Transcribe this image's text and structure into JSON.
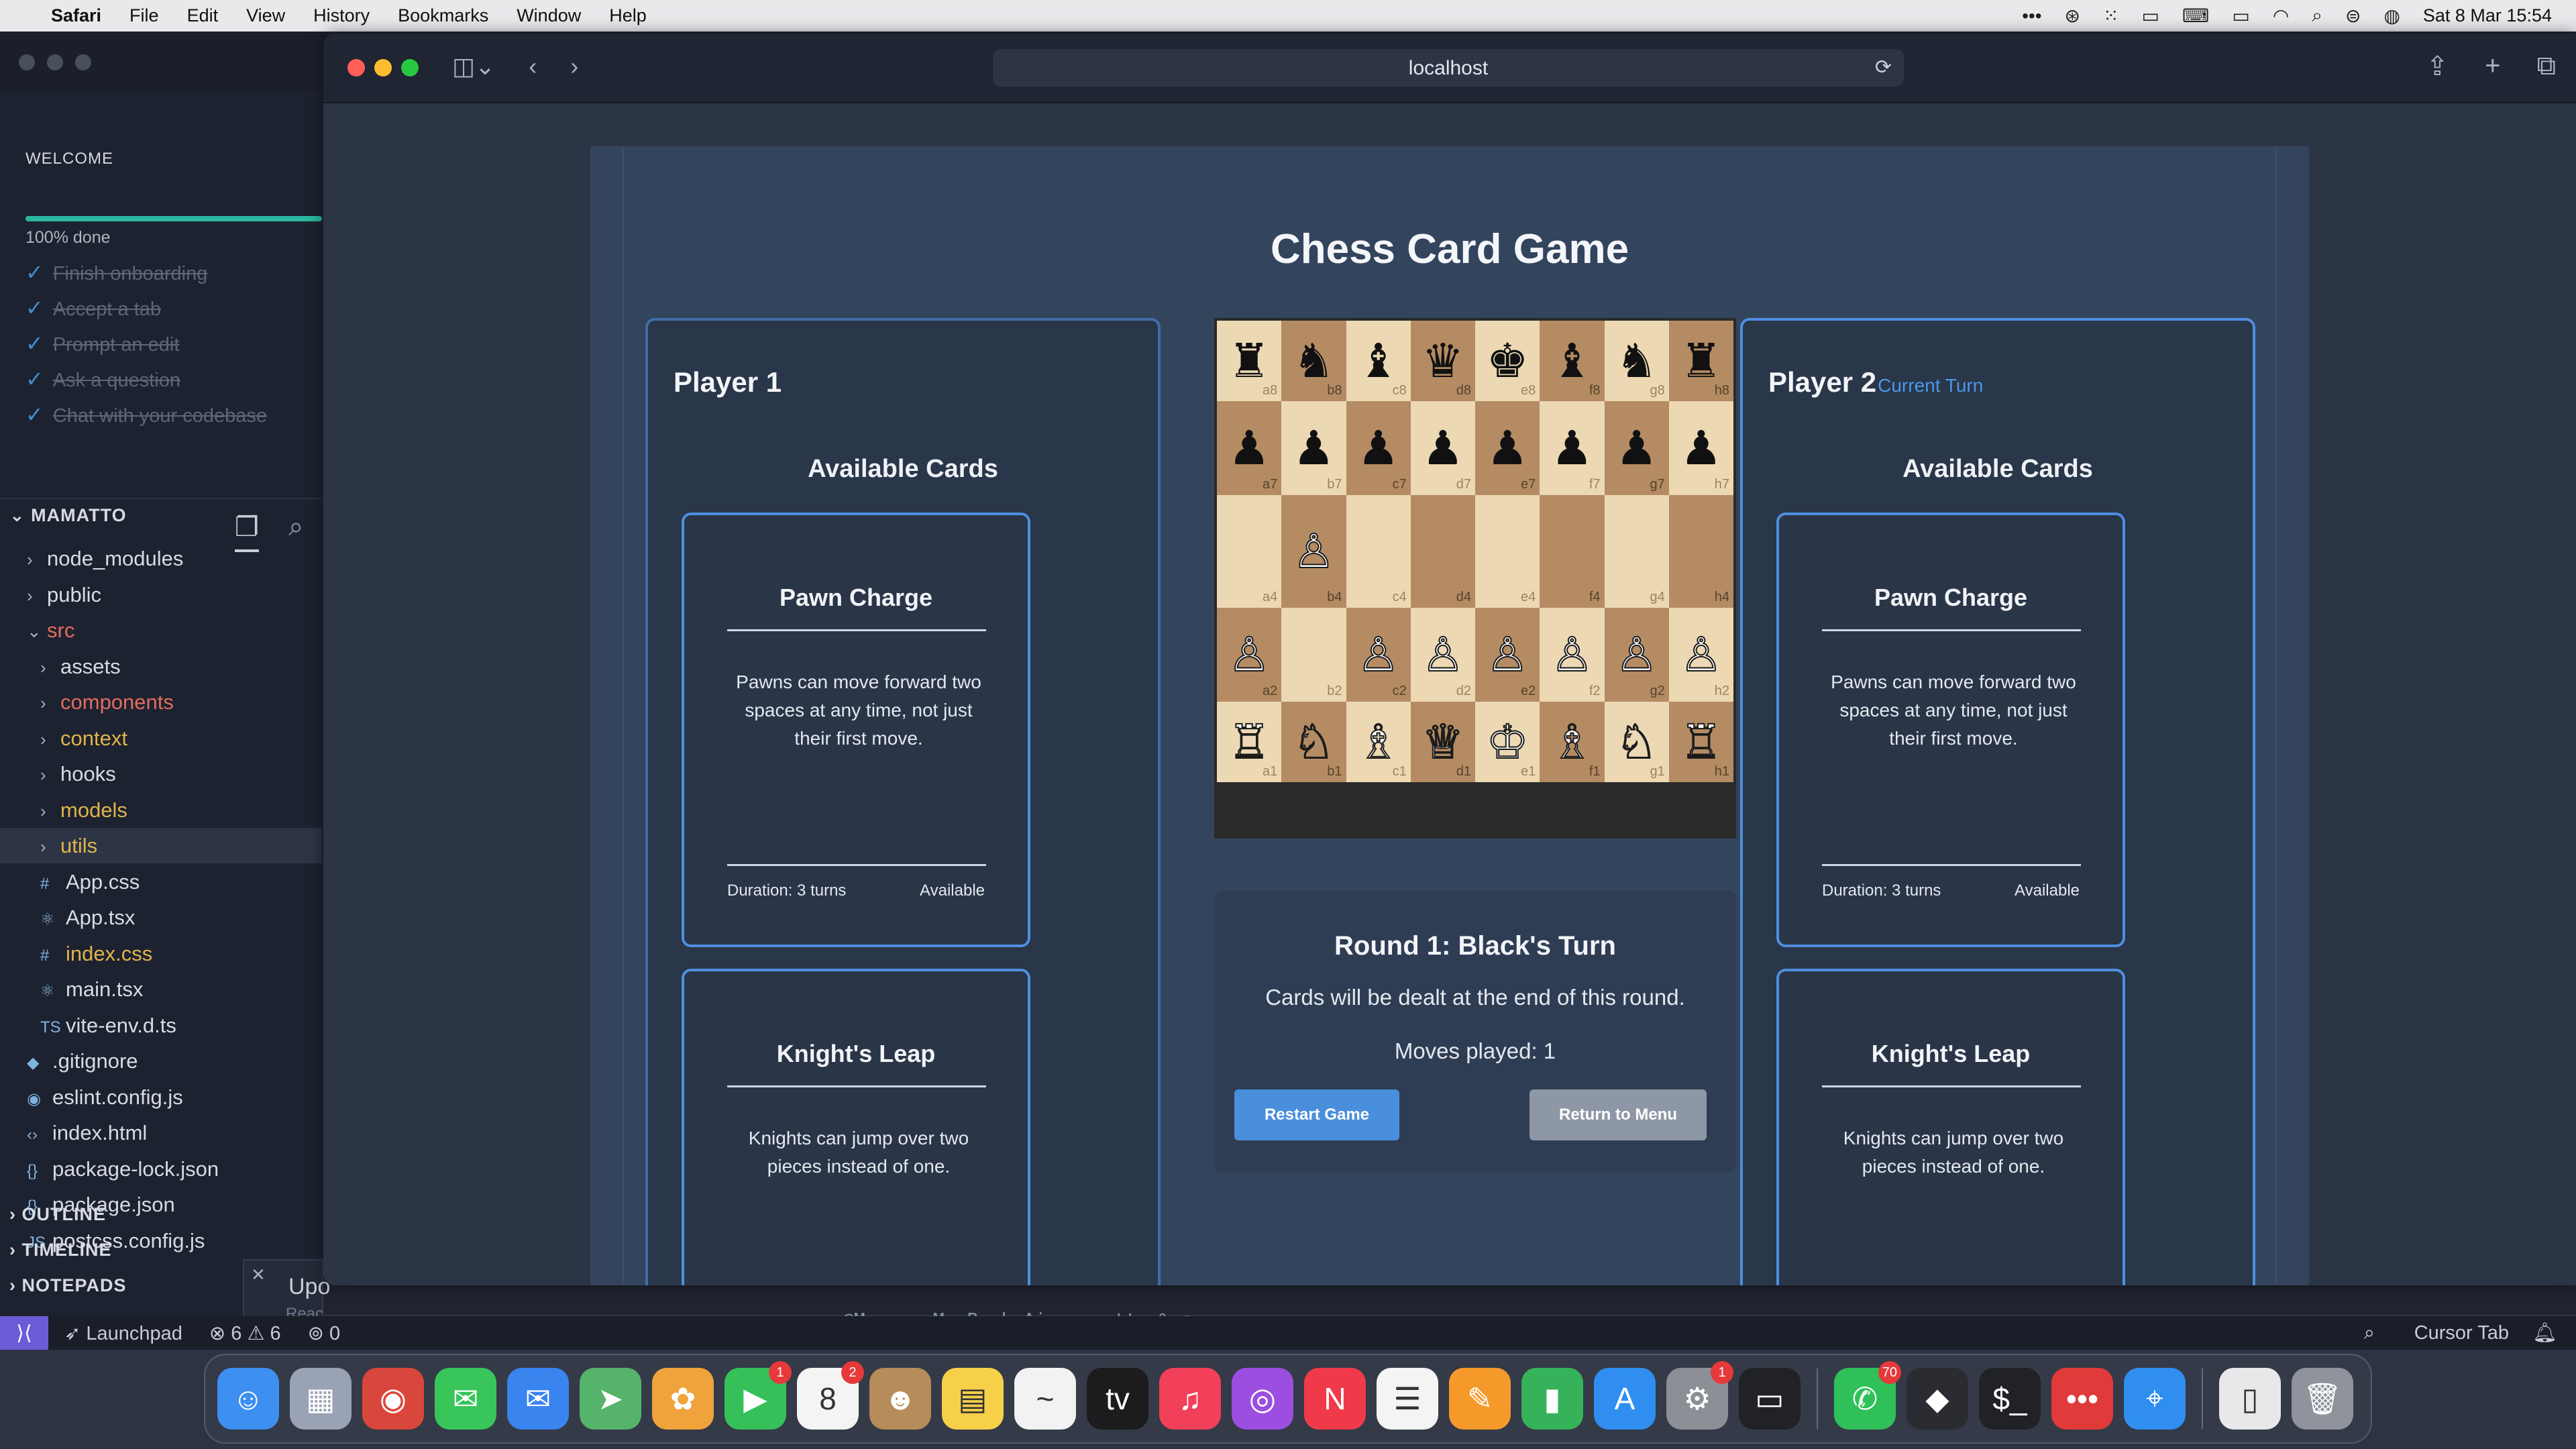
{
  "menubar": {
    "app": "Safari",
    "items": [
      "File",
      "Edit",
      "View",
      "History",
      "Bookmarks",
      "Window",
      "Help"
    ],
    "clock": "Sat 8 Mar  15:54"
  },
  "vscode": {
    "welcome": {
      "title": "WELCOME",
      "progress_pct": 100,
      "progress_label": "100% done",
      "todos": [
        "Finish onboarding",
        "Accept a tab",
        "Prompt an edit",
        "Ask a question",
        "Chat with your codebase"
      ]
    },
    "explorer": {
      "project": "MAMATTO",
      "tree": [
        {
          "label": "node_modules",
          "kind": "folder",
          "depth": 1,
          "color": "normal"
        },
        {
          "label": "public",
          "kind": "folder",
          "depth": 1,
          "color": "normal"
        },
        {
          "label": "src",
          "kind": "folder-open",
          "depth": 1,
          "color": "red"
        },
        {
          "label": "assets",
          "kind": "folder",
          "depth": 2,
          "color": "normal"
        },
        {
          "label": "components",
          "kind": "folder",
          "depth": 2,
          "color": "red"
        },
        {
          "label": "context",
          "kind": "folder",
          "depth": 2,
          "color": "yellow"
        },
        {
          "label": "hooks",
          "kind": "folder",
          "depth": 2,
          "color": "normal"
        },
        {
          "label": "models",
          "kind": "folder",
          "depth": 2,
          "color": "yellow"
        },
        {
          "label": "utils",
          "kind": "folder",
          "depth": 2,
          "color": "yellow",
          "selected": true
        },
        {
          "label": "App.css",
          "kind": "css",
          "depth": 2,
          "color": "normal"
        },
        {
          "label": "App.tsx",
          "kind": "react",
          "depth": 2,
          "color": "normal"
        },
        {
          "label": "index.css",
          "kind": "css",
          "depth": 2,
          "color": "yellow"
        },
        {
          "label": "main.tsx",
          "kind": "react",
          "depth": 2,
          "color": "normal"
        },
        {
          "label": "vite-env.d.ts",
          "kind": "ts",
          "depth": 2,
          "color": "normal"
        },
        {
          "label": ".gitignore",
          "kind": "git",
          "depth": 1,
          "color": "normal"
        },
        {
          "label": "eslint.config.js",
          "kind": "eslint",
          "depth": 1,
          "color": "normal"
        },
        {
          "label": "index.html",
          "kind": "html",
          "depth": 1,
          "color": "normal"
        },
        {
          "label": "package-lock.json",
          "kind": "json",
          "depth": 1,
          "color": "normal"
        },
        {
          "label": "package.json",
          "kind": "json",
          "depth": 1,
          "color": "normal"
        },
        {
          "label": "postcss.config.js",
          "kind": "js",
          "depth": 1,
          "color": "normal"
        }
      ],
      "sections": [
        "OUTLINE",
        "TIMELINE",
        "NOTEPADS"
      ]
    },
    "notification_peek": {
      "title": "Upo",
      "subtitle": "Reac"
    },
    "terminal_line": "marcocr@Marcos-MacBook-Air mamatto % ",
    "statusbar": {
      "launchpad": "Launchpad",
      "errors": "6",
      "warnings": "6",
      "ports": "0",
      "cursor_tab": "Cursor Tab"
    }
  },
  "safari": {
    "url": "localhost"
  },
  "game": {
    "title": "Chess Card Game",
    "available_cards_heading": "Available Cards",
    "players": [
      {
        "name": "Player 1",
        "current_turn_label": "",
        "cards": [
          {
            "title": "Pawn Charge",
            "description": "Pawns can move forward two spaces at any time, not just their first move.",
            "duration": "Duration: 3 turns",
            "status": "Available"
          },
          {
            "title": "Knight's Leap",
            "description": "Knights can jump over two pieces instead of one.",
            "duration": "",
            "status": ""
          }
        ]
      },
      {
        "name": "Player 2",
        "current_turn_label": "Current Turn",
        "cards": [
          {
            "title": "Pawn Charge",
            "description": "Pawns can move forward two spaces at any time, not just their first move.",
            "duration": "Duration: 3 turns",
            "status": "Available"
          },
          {
            "title": "Knight's Leap",
            "description": "Knights can jump over two pieces instead of one.",
            "duration": "",
            "status": ""
          }
        ]
      }
    ],
    "board": {
      "files": [
        "a",
        "b",
        "c",
        "d",
        "e",
        "f",
        "g",
        "h"
      ],
      "ranks": [
        [
          "br",
          "bn",
          "bb",
          "bq",
          "bk",
          "bb",
          "bn",
          "br"
        ],
        [
          "bp",
          "bp",
          "bp",
          "bp",
          "bp",
          "bp",
          "bp",
          "bp"
        ],
        [
          "",
          "wp",
          "",
          "",
          "",
          "",
          "",
          ""
        ],
        [
          "wp",
          "",
          "wp",
          "wp",
          "wp",
          "wp",
          "wp",
          "wp"
        ],
        [
          "wr",
          "wn",
          "wb",
          "wq",
          "wk",
          "wb",
          "wn",
          "wr"
        ]
      ],
      "rank_labels": [
        "8",
        "7",
        "4",
        "2",
        "1"
      ]
    },
    "status": {
      "round": "Round 1: Black's Turn",
      "deal_note": "Cards will be dealt at the end of this round.",
      "moves_label": "Moves played:",
      "moves_value": "1"
    },
    "buttons": {
      "restart": "Restart Game",
      "menu": "Return to Menu"
    }
  },
  "dock": {
    "apps": [
      {
        "name": "Finder",
        "color": "#3d8ff0",
        "glyph": "☺"
      },
      {
        "name": "Launchpad",
        "color": "#9aa3b5",
        "glyph": "▦"
      },
      {
        "name": "Chrome",
        "color": "#d9463b",
        "glyph": "◉"
      },
      {
        "name": "Messages",
        "color": "#38c55a",
        "glyph": "✉"
      },
      {
        "name": "Mail",
        "color": "#3a84f0",
        "glyph": "✉"
      },
      {
        "name": "Maps",
        "color": "#55b36a",
        "glyph": "➤"
      },
      {
        "name": "Photos",
        "color": "#f0a33a",
        "glyph": "✿"
      },
      {
        "name": "FaceTime",
        "color": "#35c05a",
        "glyph": "▶",
        "badge": "1"
      },
      {
        "name": "Calendar",
        "color": "#f4f4f4",
        "glyph": "8",
        "badge": "2"
      },
      {
        "name": "Contacts",
        "color": "#b58c5a",
        "glyph": "☻"
      },
      {
        "name": "Notes",
        "color": "#f7d04a",
        "glyph": "▤"
      },
      {
        "name": "Freeform",
        "color": "#f2f2f2",
        "glyph": "~"
      },
      {
        "name": "TV",
        "color": "#1c1c1e",
        "glyph": "tv"
      },
      {
        "name": "Music",
        "color": "#f2405a",
        "glyph": "♫"
      },
      {
        "name": "Podcasts",
        "color": "#9b4ee0",
        "glyph": "◎"
      },
      {
        "name": "News",
        "color": "#f03a4a",
        "glyph": "N"
      },
      {
        "name": "Reminders",
        "color": "#f4f4f4",
        "glyph": "☰"
      },
      {
        "name": "Pages",
        "color": "#f59a2a",
        "glyph": "✎"
      },
      {
        "name": "Numbers",
        "color": "#36b35a",
        "glyph": "▮"
      },
      {
        "name": "App Store",
        "color": "#2f8ef0",
        "glyph": "A"
      },
      {
        "name": "System Settings",
        "color": "#8c8f96",
        "glyph": "⚙",
        "badge": "1"
      },
      {
        "name": "Terminal Preview",
        "color": "#202226",
        "glyph": "▭"
      },
      {
        "name": "WhatsApp",
        "color": "#30c05a",
        "glyph": "✆",
        "badge": "70"
      },
      {
        "name": "Cursor",
        "color": "#2a2c31",
        "glyph": "◆"
      },
      {
        "name": "Terminal",
        "color": "#202226",
        "glyph": "$_"
      },
      {
        "name": "More",
        "color": "#e03a3a",
        "glyph": "•••"
      },
      {
        "name": "Safari",
        "color": "#2f8ef0",
        "glyph": "⌖"
      },
      {
        "name": "Document",
        "color": "#e8e8ea",
        "glyph": "▯"
      },
      {
        "name": "Trash",
        "color": "#8f939b",
        "glyph": "🗑"
      }
    ]
  }
}
